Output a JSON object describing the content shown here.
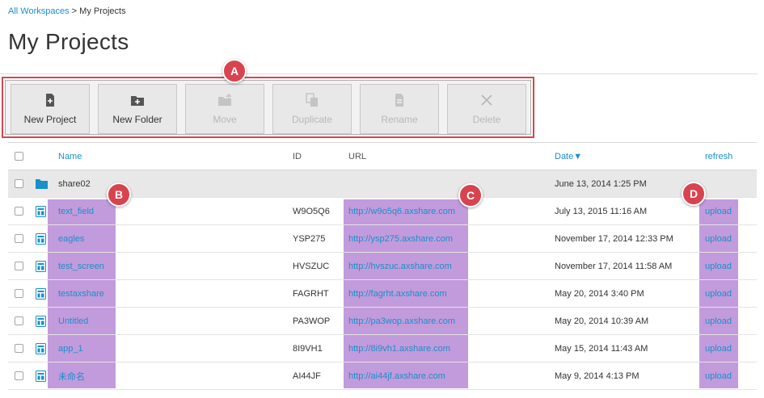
{
  "breadcrumb": {
    "root": "All Workspaces",
    "separator": " > ",
    "current": "My Projects"
  },
  "page": {
    "title": "My Projects"
  },
  "toolbar": {
    "buttons": [
      {
        "label": "New Project",
        "icon": "new-project-icon",
        "enabled": true
      },
      {
        "label": "New Folder",
        "icon": "new-folder-icon",
        "enabled": true
      },
      {
        "label": "Move",
        "icon": "move-icon",
        "enabled": false
      },
      {
        "label": "Duplicate",
        "icon": "duplicate-icon",
        "enabled": false
      },
      {
        "label": "Rename",
        "icon": "rename-icon",
        "enabled": false
      },
      {
        "label": "Delete",
        "icon": "delete-icon",
        "enabled": false
      }
    ]
  },
  "badges": {
    "a": "A",
    "b": "B",
    "c": "C",
    "d": "D"
  },
  "table": {
    "headers": {
      "name": "Name",
      "id": "ID",
      "url": "URL",
      "date": "Date▼",
      "refresh": "refresh"
    },
    "folder": {
      "name": "share02",
      "date": "June 13, 2014 1:25 PM"
    },
    "rows": [
      {
        "name": "text_field",
        "id": "W9O5Q6",
        "url": "http://w9o5q6.axshare.com",
        "date": "July 13, 2015 11:16 AM",
        "action": "upload"
      },
      {
        "name": "eagles",
        "id": "YSP275",
        "url": "http://ysp275.axshare.com",
        "date": "November 17, 2014 12:33 PM",
        "action": "upload"
      },
      {
        "name": "test_screen",
        "id": "HVSZUC",
        "url": "http://hvszuc.axshare.com",
        "date": "November 17, 2014 11:58 AM",
        "action": "upload"
      },
      {
        "name": "testaxshare",
        "id": "FAGRHT",
        "url": "http://fagrht.axshare.com",
        "date": "May 20, 2014 3:40 PM",
        "action": "upload"
      },
      {
        "name": "Untitled",
        "id": "PA3WOP",
        "url": "http://pa3wop.axshare.com",
        "date": "May 20, 2014 10:39 AM",
        "action": "upload"
      },
      {
        "name": "app_1",
        "id": "8I9VH1",
        "url": "http://8i9vh1.axshare.com",
        "date": "May 15, 2014 11:43 AM",
        "action": "upload"
      },
      {
        "name": "未命名",
        "id": "AI44JF",
        "url": "http://ai44jf.axshare.com",
        "date": "May 9, 2014 4:13 PM",
        "action": "upload"
      }
    ]
  },
  "colors": {
    "accent": "#1a8fc9",
    "badge": "#d9434f",
    "highlight": "#b78ad6"
  }
}
